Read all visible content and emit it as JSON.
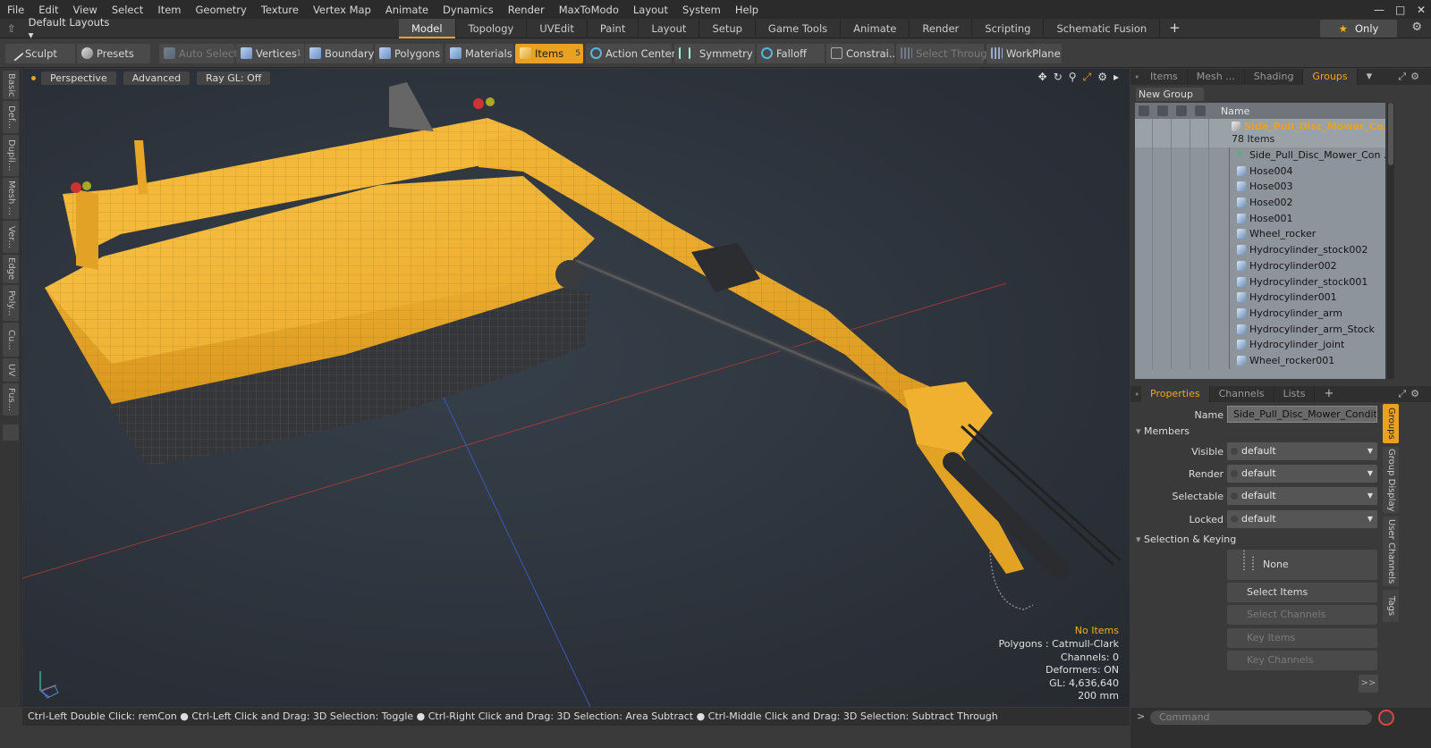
{
  "menu": [
    "File",
    "Edit",
    "View",
    "Select",
    "Item",
    "Geometry",
    "Texture",
    "Vertex Map",
    "Animate",
    "Dynamics",
    "Render",
    "MaxToModo",
    "Layout",
    "System",
    "Help"
  ],
  "layout": {
    "selector": "Default Layouts ▾",
    "tabs": [
      "Model",
      "Topology",
      "UVEdit",
      "Paint",
      "Layout",
      "Setup",
      "Game Tools",
      "Animate",
      "Render",
      "Scripting",
      "Schematic Fusion"
    ],
    "active_tab": "Model",
    "only_label": "Only"
  },
  "toolbar": {
    "sculpt": "Sculpt",
    "presets": "Presets",
    "auto_select": "Auto Select",
    "vertices": "Vertices",
    "vertices_count": "1",
    "boundary": "Boundary",
    "polygons": "Polygons",
    "materials": "Materials",
    "items": "Items",
    "items_count": "5",
    "action_center": "Action Center",
    "symmetry": "Symmetry",
    "falloff": "Falloff",
    "constraints": "Constrai...",
    "select_through": "Select Through",
    "workplane": "WorkPlane"
  },
  "left_tabs": [
    "Basic",
    "Def...",
    "Dupli...",
    "Mesh ...",
    "Ver...",
    "Edge",
    "Poly...",
    "Cu...",
    "UV",
    "Fus..."
  ],
  "viewport": {
    "perspective": "Perspective",
    "advanced": "Advanced",
    "raygl": "Ray GL: Off",
    "info": {
      "no_items": "No Items",
      "polygons": "Polygons : Catmull-Clark",
      "channels": "Channels: 0",
      "deformers": "Deformers: ON",
      "gl": "GL: 4,636,640",
      "scale": "200 mm"
    }
  },
  "items_panel": {
    "tabs": [
      "Items",
      "Mesh ...",
      "Shading",
      "Groups"
    ],
    "active_tab": "Groups",
    "new_group": "New Group",
    "name_header": "Name",
    "group_name": "Side_Pull_Disc_Mower_Co...",
    "group_count": "78 Items",
    "items": [
      "Side_Pull_Disc_Mower_Con ...",
      "Hose004",
      "Hose003",
      "Hose002",
      "Hose001",
      "Wheel_rocker",
      "Hydrocylinder_stock002",
      "Hydrocylinder002",
      "Hydrocylinder_stock001",
      "Hydrocylinder001",
      "Hydrocylinder_arm",
      "Hydrocylinder_arm_Stock",
      "Hydrocylinder_joint",
      "Wheel_rocker001"
    ]
  },
  "properties": {
    "tabs": [
      "Properties",
      "Channels",
      "Lists"
    ],
    "active_tab": "Properties",
    "name_label": "Name",
    "name_value": "Side_Pull_Disc_Mower_Conditioner",
    "members_label": "Members",
    "visible_label": "Visible",
    "visible_value": "default",
    "render_label": "Render",
    "render_value": "default",
    "selectable_label": "Selectable",
    "selectable_value": "default",
    "locked_label": "Locked",
    "locked_value": "default",
    "selection_keying_label": "Selection & Keying",
    "none_label": "None",
    "select_items": "Select Items",
    "select_channels": "Select Channels",
    "key_items": "Key Items",
    "key_channels": "Key Channels",
    "more": ">>",
    "side_tabs": [
      "Groups",
      "Group Display",
      "User Channels",
      "Tags"
    ]
  },
  "status_bar": "Ctrl-Left Double Click: remCon ● Ctrl-Left Click and Drag: 3D Selection: Toggle ● Ctrl-Right Click and Drag: 3D Selection: Area Subtract ● Ctrl-Middle Click and Drag: 3D Selection: Subtract Through",
  "command_placeholder": "Command",
  "colors": {
    "accent": "#e8a221",
    "model_yellow": "#f5b430",
    "viewport_bg": "#2e343c"
  }
}
